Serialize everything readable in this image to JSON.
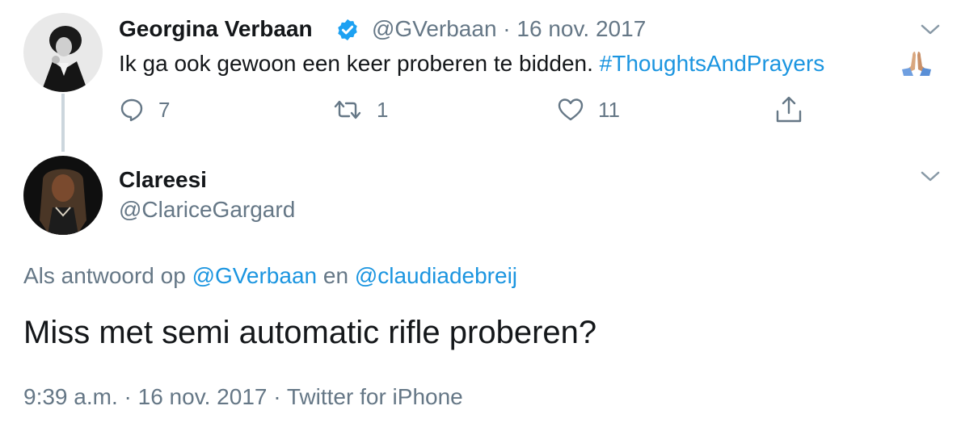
{
  "tweet1": {
    "author_name": "Georgina Verbaan",
    "handle": "@GVerbaan",
    "separator": " · ",
    "date": "16 nov. 2017",
    "text": "Ik ga ook gewoon een keer proberen te bidden. ",
    "hashtag": "#ThoughtsAndPrayers",
    "emoji": "folded-hands-emoji",
    "replies": "7",
    "retweets": "1",
    "likes": "11"
  },
  "tweet2": {
    "author_name": "Clareesi",
    "handle": "@ClariceGargard",
    "reply_prefix": "Als antwoord op ",
    "reply_mention_1": "@GVerbaan",
    "reply_and": " en ",
    "reply_mention_2": "@claudiadebreij",
    "text": "Miss met semi automatic rifle proberen?",
    "time": "9:39 a.m.",
    "separator": " · ",
    "date": "16 nov. 2017",
    "source_separator": " · ",
    "source": "Twitter for iPhone"
  },
  "icons": {
    "verified": "verified-badge-icon",
    "chevron": "chevron-down-icon",
    "reply": "reply-icon",
    "retweet": "retweet-icon",
    "like": "heart-icon",
    "share": "share-icon"
  },
  "colors": {
    "link": "#1b95e0",
    "secondary_text": "#657786",
    "primary_text": "#14171a",
    "verified": "#1da1f2",
    "thread_line": "#ccd6dd"
  }
}
